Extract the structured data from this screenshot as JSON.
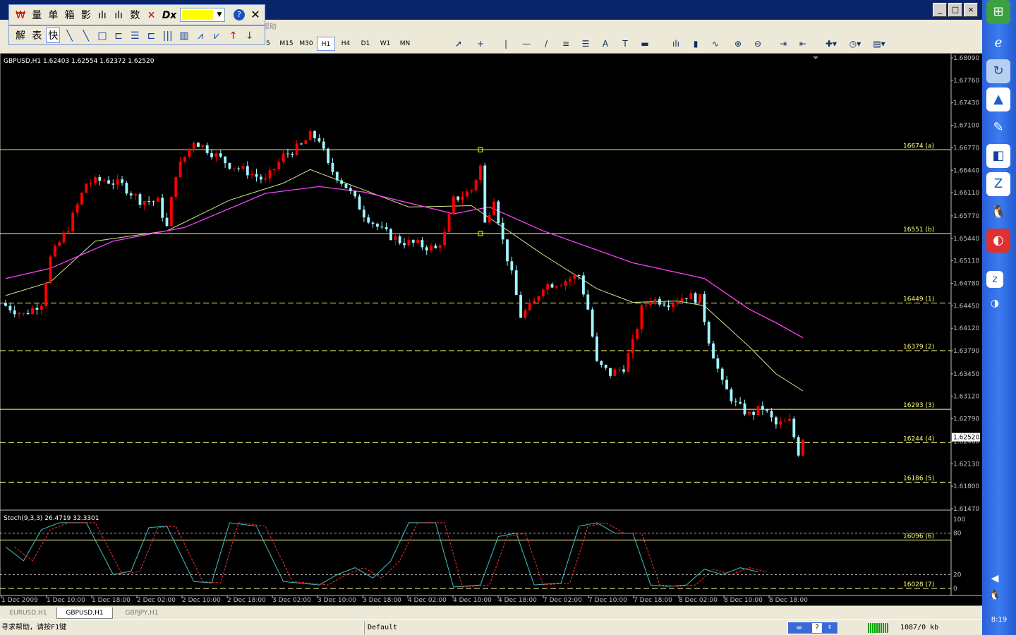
{
  "floating_toolbar_1": {
    "items": [
      "量",
      "单",
      "箱",
      "影",
      "数"
    ]
  },
  "floating_toolbar_2": {
    "items": [
      "解",
      "表",
      "快"
    ]
  },
  "menu_partial": "帮助",
  "timeframes": [
    "M15",
    "M30",
    "H1",
    "H4",
    "D1",
    "W1",
    "MN"
  ],
  "timeframe_partial": "5",
  "active_timeframe": "H1",
  "chart": {
    "header": "GBPUSD,H1  1.62403 1.62554 1.62372 1.62520",
    "indicator_header": "Stoch(9,3,3) 26.4719 32.3301",
    "current_price": "1.62520",
    "price_levels": [
      "1.68090",
      "1.67760",
      "1.67430",
      "1.67100",
      "1.66770",
      "1.66440",
      "1.66110",
      "1.65770",
      "1.65440",
      "1.65110",
      "1.64780",
      "1.64450",
      "1.64120",
      "1.63790",
      "1.63450",
      "1.63120",
      "1.62790",
      "1.62460",
      "1.62130",
      "1.61800",
      "1.61470"
    ],
    "stoch_levels": [
      "100",
      "80",
      "20",
      "0"
    ],
    "fib_lines": [
      {
        "label": "16674 (a)",
        "value": 1.6674,
        "style": "solid"
      },
      {
        "label": "16551 (b)",
        "value": 1.6551,
        "style": "solid"
      },
      {
        "label": "16449 (1)",
        "value": 1.6449,
        "style": "dashed"
      },
      {
        "label": "16379 (2)",
        "value": 1.6379,
        "style": "dashed"
      },
      {
        "label": "16293 (3)",
        "value": 1.6293,
        "style": "solid"
      },
      {
        "label": "16244 (4)",
        "value": 1.6244,
        "style": "dashed"
      },
      {
        "label": "16186 (5)",
        "value": 1.6186,
        "style": "dashed"
      }
    ],
    "stoch_lines": [
      {
        "label": "16096 (6)",
        "value": 70,
        "style": "solid"
      },
      {
        "label": "16028 (7)",
        "value": 0,
        "style": "dashed"
      }
    ],
    "time_labels": [
      "1 Dec 2009",
      "1 Dec 10:00",
      "1 Dec 18:00",
      "2 Dec 02:00",
      "2 Dec 10:00",
      "2 Dec 18:00",
      "3 Dec 02:00",
      "3 Dec 10:00",
      "3 Dec 18:00",
      "4 Dec 02:00",
      "4 Dec 10:00",
      "4 Dec 18:00",
      "7 Dec 02:00",
      "7 Dec 10:00",
      "7 Dec 18:00",
      "8 Dec 02:00",
      "8 Dec 10:00",
      "8 Dec 18:00"
    ]
  },
  "chart_data": {
    "type": "candlestick",
    "symbol": "GBPUSD",
    "timeframe": "H1",
    "y_range": [
      1.6147,
      1.6809
    ],
    "close_path": [
      {
        "t": 0,
        "c": 1.6445
      },
      {
        "t": 4,
        "c": 1.6432
      },
      {
        "t": 8,
        "c": 1.645
      },
      {
        "t": 10,
        "c": 1.6515
      },
      {
        "t": 14,
        "c": 1.656
      },
      {
        "t": 18,
        "c": 1.6625
      },
      {
        "t": 22,
        "c": 1.663
      },
      {
        "t": 26,
        "c": 1.6622
      },
      {
        "t": 30,
        "c": 1.66
      },
      {
        "t": 34,
        "c": 1.6598
      },
      {
        "t": 36,
        "c": 1.656
      },
      {
        "t": 38,
        "c": 1.664
      },
      {
        "t": 42,
        "c": 1.6688
      },
      {
        "t": 46,
        "c": 1.667
      },
      {
        "t": 50,
        "c": 1.6652
      },
      {
        "t": 54,
        "c": 1.6642
      },
      {
        "t": 58,
        "c": 1.6628
      },
      {
        "t": 62,
        "c": 1.6665
      },
      {
        "t": 66,
        "c": 1.668
      },
      {
        "t": 68,
        "c": 1.6695
      },
      {
        "t": 70,
        "c": 1.669
      },
      {
        "t": 72,
        "c": 1.665
      },
      {
        "t": 76,
        "c": 1.662
      },
      {
        "t": 80,
        "c": 1.658
      },
      {
        "t": 84,
        "c": 1.6555
      },
      {
        "t": 88,
        "c": 1.654
      },
      {
        "t": 92,
        "c": 1.6535
      },
      {
        "t": 96,
        "c": 1.6528
      },
      {
        "t": 98,
        "c": 1.655
      },
      {
        "t": 100,
        "c": 1.66
      },
      {
        "t": 104,
        "c": 1.6615
      },
      {
        "t": 106,
        "c": 1.665
      },
      {
        "t": 107,
        "c": 1.6565
      },
      {
        "t": 109,
        "c": 1.6605
      },
      {
        "t": 111,
        "c": 1.654
      },
      {
        "t": 113,
        "c": 1.649
      },
      {
        "t": 115,
        "c": 1.643
      },
      {
        "t": 118,
        "c": 1.645
      },
      {
        "t": 120,
        "c": 1.6475
      },
      {
        "t": 124,
        "c": 1.648
      },
      {
        "t": 128,
        "c": 1.649
      },
      {
        "t": 130,
        "c": 1.644
      },
      {
        "t": 132,
        "c": 1.636
      },
      {
        "t": 135,
        "c": 1.6345
      },
      {
        "t": 138,
        "c": 1.6355
      },
      {
        "t": 140,
        "c": 1.639
      },
      {
        "t": 142,
        "c": 1.644
      },
      {
        "t": 144,
        "c": 1.6455
      },
      {
        "t": 148,
        "c": 1.645
      },
      {
        "t": 152,
        "c": 1.646
      },
      {
        "t": 155,
        "c": 1.6455
      },
      {
        "t": 157,
        "c": 1.6395
      },
      {
        "t": 160,
        "c": 1.633
      },
      {
        "t": 163,
        "c": 1.63
      },
      {
        "t": 166,
        "c": 1.6285
      },
      {
        "t": 169,
        "c": 1.6295
      },
      {
        "t": 172,
        "c": 1.627
      },
      {
        "t": 175,
        "c": 1.6275
      },
      {
        "t": 177,
        "c": 1.623
      },
      {
        "t": 178,
        "c": 1.6252
      }
    ],
    "ma_fast": [
      {
        "t": 0,
        "v": 1.646
      },
      {
        "t": 10,
        "v": 1.648
      },
      {
        "t": 20,
        "v": 1.654
      },
      {
        "t": 36,
        "v": 1.6555
      },
      {
        "t": 50,
        "v": 1.66
      },
      {
        "t": 62,
        "v": 1.6625
      },
      {
        "t": 68,
        "v": 1.6645
      },
      {
        "t": 76,
        "v": 1.6625
      },
      {
        "t": 90,
        "v": 1.659
      },
      {
        "t": 104,
        "v": 1.6592
      },
      {
        "t": 110,
        "v": 1.6565
      },
      {
        "t": 120,
        "v": 1.652
      },
      {
        "t": 132,
        "v": 1.647
      },
      {
        "t": 140,
        "v": 1.645
      },
      {
        "t": 150,
        "v": 1.6452
      },
      {
        "t": 156,
        "v": 1.6445
      },
      {
        "t": 166,
        "v": 1.6385
      },
      {
        "t": 172,
        "v": 1.6345
      },
      {
        "t": 178,
        "v": 1.632
      }
    ],
    "ma_slow": [
      {
        "t": 0,
        "v": 1.6485
      },
      {
        "t": 10,
        "v": 1.65
      },
      {
        "t": 24,
        "v": 1.654
      },
      {
        "t": 40,
        "v": 1.656
      },
      {
        "t": 58,
        "v": 1.661
      },
      {
        "t": 70,
        "v": 1.662
      },
      {
        "t": 80,
        "v": 1.6612
      },
      {
        "t": 100,
        "v": 1.658
      },
      {
        "t": 108,
        "v": 1.659
      },
      {
        "t": 120,
        "v": 1.6555
      },
      {
        "t": 140,
        "v": 1.6508
      },
      {
        "t": 156,
        "v": 1.6485
      },
      {
        "t": 166,
        "v": 1.644
      },
      {
        "t": 172,
        "v": 1.642
      },
      {
        "t": 178,
        "v": 1.6398
      }
    ],
    "stochastic": [
      {
        "t": 0,
        "v": 60
      },
      {
        "t": 4,
        "v": 40
      },
      {
        "t": 8,
        "v": 85
      },
      {
        "t": 12,
        "v": 95
      },
      {
        "t": 18,
        "v": 95
      },
      {
        "t": 24,
        "v": 20
      },
      {
        "t": 28,
        "v": 25
      },
      {
        "t": 32,
        "v": 88
      },
      {
        "t": 36,
        "v": 90
      },
      {
        "t": 42,
        "v": 10
      },
      {
        "t": 46,
        "v": 8
      },
      {
        "t": 50,
        "v": 95
      },
      {
        "t": 56,
        "v": 90
      },
      {
        "t": 62,
        "v": 10
      },
      {
        "t": 70,
        "v": 5
      },
      {
        "t": 74,
        "v": 20
      },
      {
        "t": 78,
        "v": 30
      },
      {
        "t": 82,
        "v": 15
      },
      {
        "t": 86,
        "v": 40
      },
      {
        "t": 90,
        "v": 95
      },
      {
        "t": 96,
        "v": 95
      },
      {
        "t": 100,
        "v": 2
      },
      {
        "t": 106,
        "v": 5
      },
      {
        "t": 110,
        "v": 75
      },
      {
        "t": 114,
        "v": 80
      },
      {
        "t": 118,
        "v": 5
      },
      {
        "t": 124,
        "v": 8
      },
      {
        "t": 128,
        "v": 90
      },
      {
        "t": 132,
        "v": 95
      },
      {
        "t": 136,
        "v": 80
      },
      {
        "t": 140,
        "v": 80
      },
      {
        "t": 144,
        "v": 5
      },
      {
        "t": 148,
        "v": 3
      },
      {
        "t": 152,
        "v": 5
      },
      {
        "t": 156,
        "v": 28
      },
      {
        "t": 160,
        "v": 20
      },
      {
        "t": 164,
        "v": 30
      },
      {
        "t": 168,
        "v": 24
      }
    ],
    "stoch_range": [
      0,
      100
    ]
  },
  "tabs": [
    "EURUSD,H1",
    "GBPUSD,H1",
    "GBPJPY,H1"
  ],
  "active_tab": "GBPUSD,H1",
  "status": {
    "help": "寻求帮助，请按F1键",
    "profile": "Default",
    "traffic": "1087/0 kb"
  },
  "clock": "8:19",
  "colors": {
    "background": "#000000",
    "bull_candle": "#ff0000",
    "bear_candle": "#9ff7ff",
    "fib": "#ffff80",
    "ma_fast": "#d0e890",
    "ma_slow": "#ff40ff",
    "stoch_main": "#40c0c0",
    "stoch_signal": "#ff3030"
  }
}
